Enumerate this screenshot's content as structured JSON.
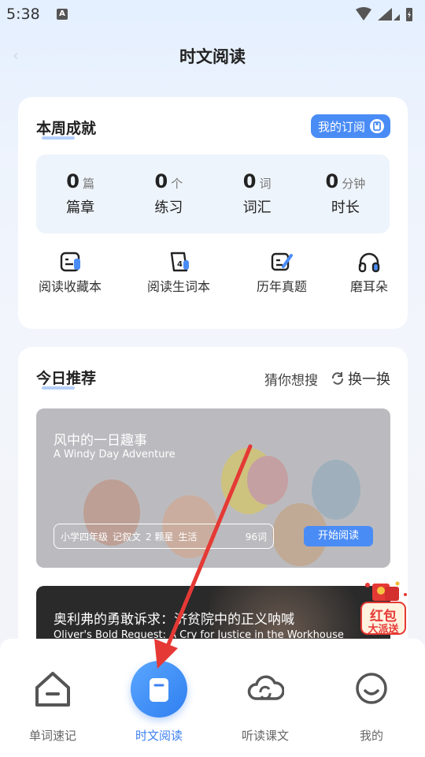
{
  "status_bar": {
    "time": "5:38",
    "notification_icon": "A"
  },
  "header": {
    "title": "时文阅读",
    "back_icon": "‹"
  },
  "weekly": {
    "title": "本周成就",
    "subscribe_label": "我的订阅",
    "stats": [
      {
        "value": "0",
        "unit": "篇",
        "label": "篇章"
      },
      {
        "value": "0",
        "unit": "个",
        "label": "练习"
      },
      {
        "value": "0",
        "unit": "词",
        "label": "词汇"
      },
      {
        "value": "0",
        "unit": "分钟",
        "label": "时长"
      }
    ],
    "tools": [
      {
        "label": "阅读收藏本",
        "icon": "bookmark-doc-icon"
      },
      {
        "label": "阅读生词本",
        "icon": "vocab-book-icon"
      },
      {
        "label": "历年真题",
        "icon": "exam-pen-icon"
      },
      {
        "label": "磨耳朵",
        "icon": "headphones-icon"
      }
    ]
  },
  "recommend": {
    "title": "今日推荐",
    "guess_label": "猜你想搜",
    "swap_label": "换一换",
    "articles": [
      {
        "title": "风中的一日趣事",
        "subtitle": "A Windy Day Adventure",
        "grade": "小学四年级",
        "genre": "记叙文",
        "stars": "2 颗星",
        "topic": "生活",
        "words": "96词",
        "start_label": "开始阅读"
      },
      {
        "title": "奥利弗的勇敢诉求：济贫院中的正义呐喊",
        "subtitle": "Oliver's Bold Request: A Cry for Justice in the Workhouse"
      }
    ]
  },
  "promo": {
    "line1": "红包",
    "line2": "大派送"
  },
  "tabbar": {
    "items": [
      {
        "label": "单词速记",
        "icon": "home-icon",
        "active": false
      },
      {
        "label": "时文阅读",
        "icon": "bookmark-icon",
        "active": true
      },
      {
        "label": "听读课文",
        "icon": "cloud-sync-icon",
        "active": false
      },
      {
        "label": "我的",
        "icon": "smile-icon",
        "active": false
      }
    ]
  },
  "colors": {
    "accent": "#4a8cf6",
    "active_tab": "#3d7ff0",
    "annotation_arrow": "#e53935"
  }
}
